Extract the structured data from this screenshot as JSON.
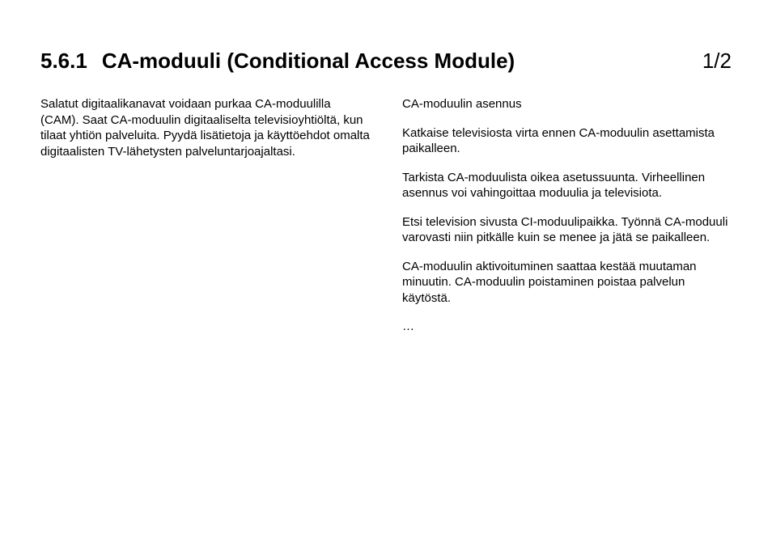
{
  "heading": {
    "section_number": "5.6.1",
    "title": "CA-moduuli (Conditional Access Module)"
  },
  "page_indicator": "1/2",
  "left_column": {
    "p1": "Salatut digitaalikanavat voidaan purkaa CA-moduulilla (CAM). Saat CA-moduulin digitaaliselta televisioyhtiöltä, kun tilaat yhtiön palveluita. Pyydä lisätietoja ja käyttöehdot omalta digitaalisten TV-lähetysten palveluntarjoajaltasi."
  },
  "right_column": {
    "subheading": "CA-moduulin asennus",
    "p1": "Katkaise televisiosta virta ennen CA-moduulin asettamista paikalleen.",
    "p2": "Tarkista CA-moduulista oikea asetussuunta. Virheellinen asennus voi vahingoittaa moduulia ja televisiota.",
    "p3": "Etsi television sivusta CI-moduulipaikka. Työnnä CA-moduuli varovasti niin pitkälle kuin se menee ja jätä se paikalleen.",
    "p4": "CA-moduulin aktivoituminen saattaa kestää muutaman minuutin. CA-moduulin poistaminen poistaa palvelun käytöstä.",
    "ellipsis": "…"
  }
}
